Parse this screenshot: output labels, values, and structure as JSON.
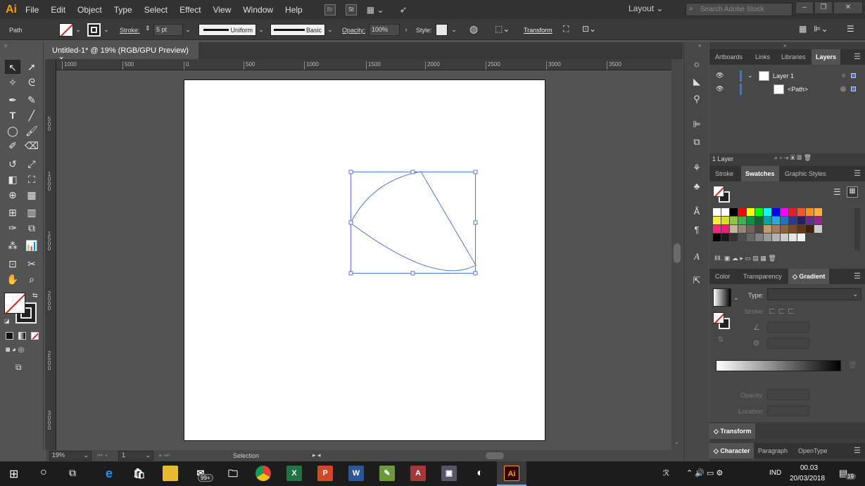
{
  "app": {
    "logo": "Ai",
    "menus": [
      "File",
      "Edit",
      "Object",
      "Type",
      "Select",
      "Effect",
      "View",
      "Window",
      "Help"
    ],
    "bridge": "Br",
    "stock": "St"
  },
  "workspace": {
    "label": "Layout",
    "search_placeholder": "Search Adobe Stock"
  },
  "control": {
    "selection_type": "Path",
    "stroke_label": "Stroke:",
    "stroke_weight": "5 pt",
    "profile": "Uniform",
    "brush": "Basic",
    "opacity_label": "Opacity:",
    "opacity": "100%",
    "style_label": "Style:",
    "transform": "Transform"
  },
  "document": {
    "tab_title": "Untitled-1* @ 19% (RGB/GPU Preview)",
    "close": "×"
  },
  "ruler": {
    "h_labels": [
      "1000",
      "500",
      "0",
      "500",
      "1000",
      "1500",
      "2000",
      "2500",
      "3000",
      "3500"
    ],
    "v_labels": [
      "5\n0\n0",
      "1\n0\n0\n0",
      "1\n5\n0\n0",
      "2\n0\n0\n0",
      "2\n5\n0\n0",
      "3\n0\n0\n0"
    ]
  },
  "status": {
    "zoom": "19%",
    "artboard_num": "1",
    "tool": "Selection"
  },
  "layers_panel": {
    "tabs": [
      "Artboards",
      "Links",
      "Libraries",
      "Layers"
    ],
    "active_tab": "Layers",
    "layers": [
      {
        "name": "Layer 1"
      },
      {
        "name": "<Path>"
      }
    ],
    "footer": "1 Layer"
  },
  "swatches_panel": {
    "tabs": [
      "Stroke",
      "Swatches",
      "Graphic Styles"
    ],
    "active_tab": "Swatches"
  },
  "gradient_panel": {
    "tabs": [
      "Color",
      "Transparency",
      "Gradient"
    ],
    "active_tab": "Gradient",
    "type_label": "Type:",
    "stroke_label": "Stroke:",
    "opacity_label": "Opacity:",
    "location_label": "Location:"
  },
  "collapsed_panels": {
    "transform": "Transform",
    "character_tabs": [
      "Character",
      "Paragraph",
      "OpenType"
    ]
  },
  "taskbar": {
    "notification_badge": "99+",
    "language": "IND",
    "time": "00.03",
    "date": "20/03/2018",
    "notif_count": "19"
  },
  "swatch_colors": [
    "#ffffff",
    "#ffffff",
    "#000000",
    "#ff0000",
    "#ffff00",
    "#00ff00",
    "#00ffff",
    "#0000ff",
    "#ff00ff",
    "#e21f26",
    "#f05a28",
    "#f6921e",
    "#fbb040",
    "#f9ed32",
    "#d7df23",
    "#8dc63f",
    "#39b54a",
    "#009444",
    "#006838",
    "#00a79d",
    "#27aae1",
    "#1c75bc",
    "#2b3990",
    "#262262",
    "#662d91",
    "#92278f",
    "#ee2a7b",
    "#ed1e79",
    "#c2b59b",
    "#998675",
    "#736357",
    "#534741",
    "#c69c6d",
    "#a67c52",
    "#8c6239",
    "#754c24",
    "#603913",
    "#42210b",
    "#cccccc",
    "#000000",
    "#1a1a1a",
    "#333333",
    "#4d4d4d",
    "#666666",
    "#808080",
    "#999999",
    "#b3b3b3",
    "#cccccc",
    "#e6e6e6",
    "#f2f2f2"
  ],
  "colors": {
    "selection": "#4a6fd6",
    "accent": "#ff9a00"
  }
}
